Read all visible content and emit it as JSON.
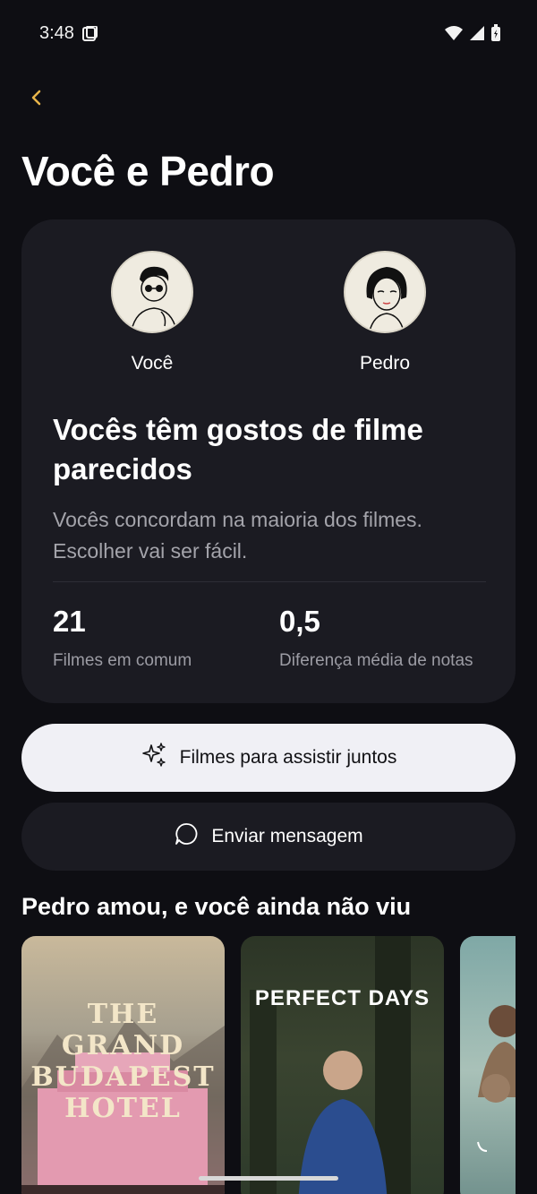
{
  "status_bar": {
    "time": "3:48",
    "icons": [
      "sim-card-icon",
      "wifi-icon",
      "signal-icon",
      "battery-icon"
    ]
  },
  "header": {
    "back_icon": "chevron-left-icon",
    "title": "Você e Pedro"
  },
  "match_card": {
    "you": {
      "name": "Você",
      "avatar": "avatar-you"
    },
    "friend": {
      "name": "Pedro",
      "avatar": "avatar-pedro"
    },
    "heading": "Vocês têm gostos de filme parecidos",
    "description": "Vocês concordam na maioria dos filmes. Escolher vai ser fácil.",
    "stats": [
      {
        "value": "21",
        "label": "Filmes em comum"
      },
      {
        "value": "0,5",
        "label": "Diferença média de notas"
      }
    ]
  },
  "actions": {
    "watch_together": {
      "label": "Filmes para assistir juntos",
      "icon": "sparkles-icon"
    },
    "send_message": {
      "label": "Enviar mensagem",
      "icon": "chat-bubble-icon"
    }
  },
  "section": {
    "title": "Pedro amou, e você ainda não viu",
    "posters": [
      {
        "title": "THE GRAND BUDAPEST HOTEL"
      },
      {
        "title": "PERFECT DAYS"
      },
      {
        "title": ""
      }
    ]
  },
  "colors": {
    "background": "#0e0e13",
    "card": "#1b1b22",
    "accent": "#e8b54a",
    "primary_button": "#f0f0f5"
  }
}
